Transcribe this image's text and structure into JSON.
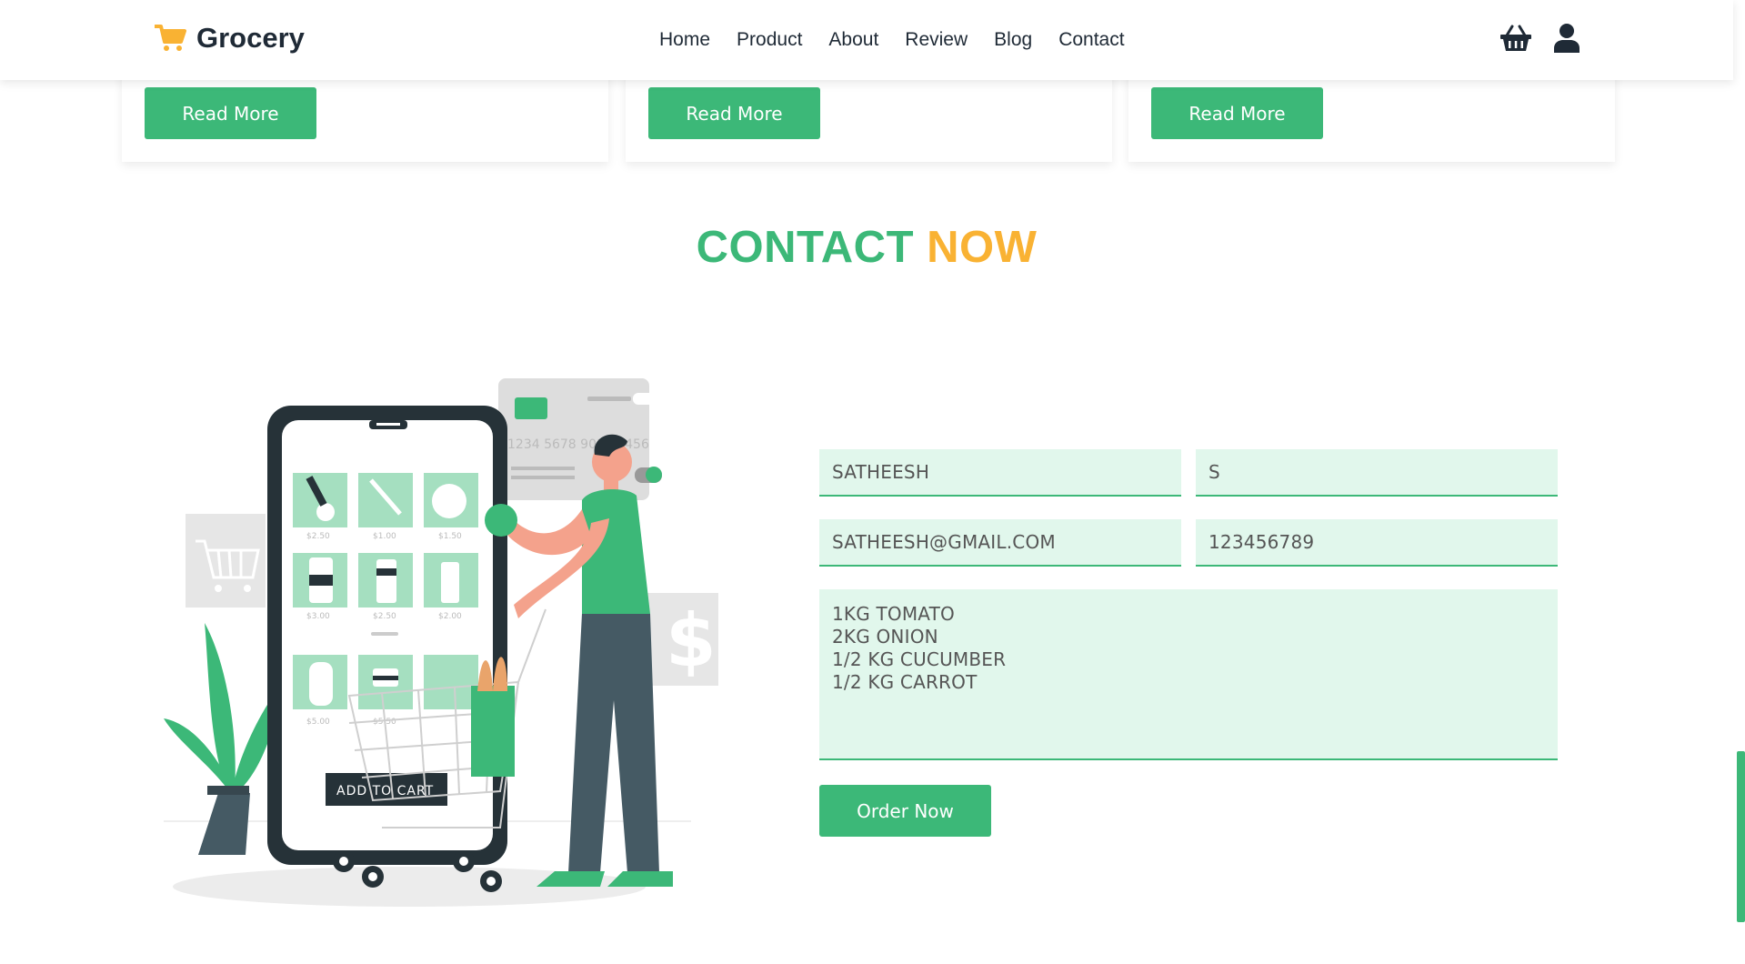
{
  "header": {
    "logo_text": "Grocery",
    "nav": [
      "Home",
      "Product",
      "About",
      "Review",
      "Blog",
      "Contact"
    ]
  },
  "cards": [
    {
      "button_label": "Read More"
    },
    {
      "button_label": "Read More"
    },
    {
      "button_label": "Read More"
    }
  ],
  "section": {
    "title_part1": "CONTACT",
    "title_part2": "NOW"
  },
  "illustration": {
    "phone_button": "ADD TO CART",
    "card_number": "1234 5678 9012 3456",
    "prices": [
      "$2.50",
      "$1.00",
      "$1.50",
      "$3.00",
      "$2.50",
      "$2.00",
      "$5.00",
      "$5.50"
    ]
  },
  "form": {
    "first_name": "SATHEESH",
    "last_name": "S",
    "email": "SATHEESH@GMAIL.COM",
    "phone": "123456789",
    "message": "1KG TOMATO\n2KG ONION\n1/2 KG CUCUMBER\n1/2 KG CARROT",
    "submit_label": "Order Now"
  },
  "colors": {
    "accent": "#3cb878",
    "highlight": "#f9b233",
    "field_bg": "#e1f7ec",
    "text_dark": "#1f2a36"
  },
  "icons": [
    "cart-logo-icon",
    "shopping-basket-icon",
    "user-icon"
  ]
}
